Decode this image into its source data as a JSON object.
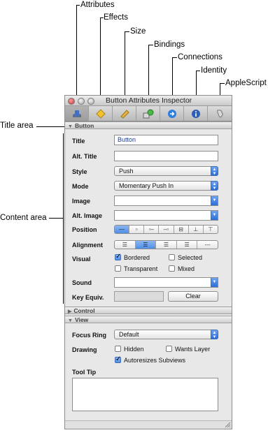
{
  "callouts": {
    "attributes": "Attributes",
    "effects": "Effects",
    "size": "Size",
    "bindings": "Bindings",
    "connections": "Connections",
    "identity": "Identity",
    "applescript": "AppleScript",
    "title_area": "Title area",
    "content_area": "Content area"
  },
  "window": {
    "title": "Button Attributes Inspector"
  },
  "toolbar": {
    "tabs": [
      {
        "name": "attributes",
        "icon": "attributes-icon"
      },
      {
        "name": "effects",
        "icon": "effects-icon"
      },
      {
        "name": "size",
        "icon": "size-ruler-icon"
      },
      {
        "name": "bindings",
        "icon": "bindings-icon"
      },
      {
        "name": "connections",
        "icon": "connections-icon"
      },
      {
        "name": "identity",
        "icon": "identity-info-icon"
      },
      {
        "name": "applescript",
        "icon": "applescript-icon"
      }
    ],
    "active": "attributes"
  },
  "button_section": {
    "header": "Button",
    "title_label": "Title",
    "title_value": "Button",
    "alt_title_label": "Alt. Title",
    "alt_title_value": "",
    "style_label": "Style",
    "style_value": "Push",
    "mode_label": "Mode",
    "mode_value": "Momentary Push In",
    "image_label": "Image",
    "image_value": "",
    "alt_image_label": "Alt. Image",
    "alt_image_value": "",
    "position_label": "Position",
    "alignment_label": "Alignment",
    "visual_label": "Visual",
    "bordered_label": "Bordered",
    "bordered_checked": true,
    "selected_label": "Selected",
    "selected_checked": false,
    "transparent_label": "Transparent",
    "transparent_checked": false,
    "mixed_label": "Mixed",
    "mixed_checked": false,
    "sound_label": "Sound",
    "sound_value": "",
    "key_equiv_label": "Key Equiv.",
    "clear_label": "Clear"
  },
  "control_section": {
    "header": "Control"
  },
  "view_section": {
    "header": "View",
    "focus_ring_label": "Focus Ring",
    "focus_ring_value": "Default",
    "drawing_label": "Drawing",
    "hidden_label": "Hidden",
    "hidden_checked": false,
    "wants_layer_label": "Wants Layer",
    "wants_layer_checked": false,
    "autoresizes_label": "Autoresizes Subviews",
    "autoresizes_checked": true,
    "tool_tip_label": "Tool Tip",
    "tool_tip_value": ""
  },
  "colors": {
    "accent_blue": "#4f8ee6",
    "window_bg": "#e8e8e8"
  }
}
